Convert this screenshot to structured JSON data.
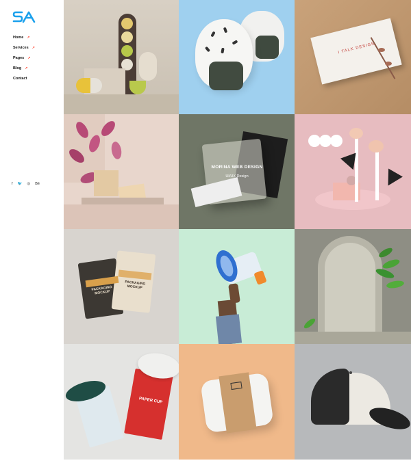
{
  "brand": {
    "logo_text": "SA"
  },
  "nav": {
    "items": [
      {
        "label": "Home",
        "has_arrow": true
      },
      {
        "label": "Services",
        "has_arrow": true
      },
      {
        "label": "Pages",
        "has_arrow": true
      },
      {
        "label": "Blog",
        "has_arrow": true
      },
      {
        "label": "Contact",
        "has_arrow": false
      }
    ],
    "arrow_glyph": "↗"
  },
  "social": [
    {
      "icon": "facebook-icon",
      "glyph": "f"
    },
    {
      "icon": "twitter-icon",
      "glyph": "🐦"
    },
    {
      "icon": "dribbble-icon",
      "glyph": "◎"
    },
    {
      "icon": "behance-icon",
      "glyph": "Bē"
    }
  ],
  "portfolio": {
    "tiles": [
      {
        "name": "tile-capsules"
      },
      {
        "name": "tile-rice-balls"
      },
      {
        "name": "tile-business-card",
        "card_text": "I TALK DESIGN."
      },
      {
        "name": "tile-leaves-blocks"
      },
      {
        "name": "tile-web-design",
        "title": "MORINA WEB DESIGN",
        "subtitle": "UI/UX Design"
      },
      {
        "name": "tile-pink-abstract"
      },
      {
        "name": "tile-packaging",
        "pouch_text": "PACKAGING MOCKUP"
      },
      {
        "name": "tile-megaphone"
      },
      {
        "name": "tile-arch-plant"
      },
      {
        "name": "tile-paper-cups",
        "cup_text": "PAPER CUP"
      },
      {
        "name": "tile-food-box"
      },
      {
        "name": "tile-cap"
      }
    ]
  },
  "colors": {
    "accent": "#1aa0ec",
    "arrow": "#ff4d3a"
  }
}
